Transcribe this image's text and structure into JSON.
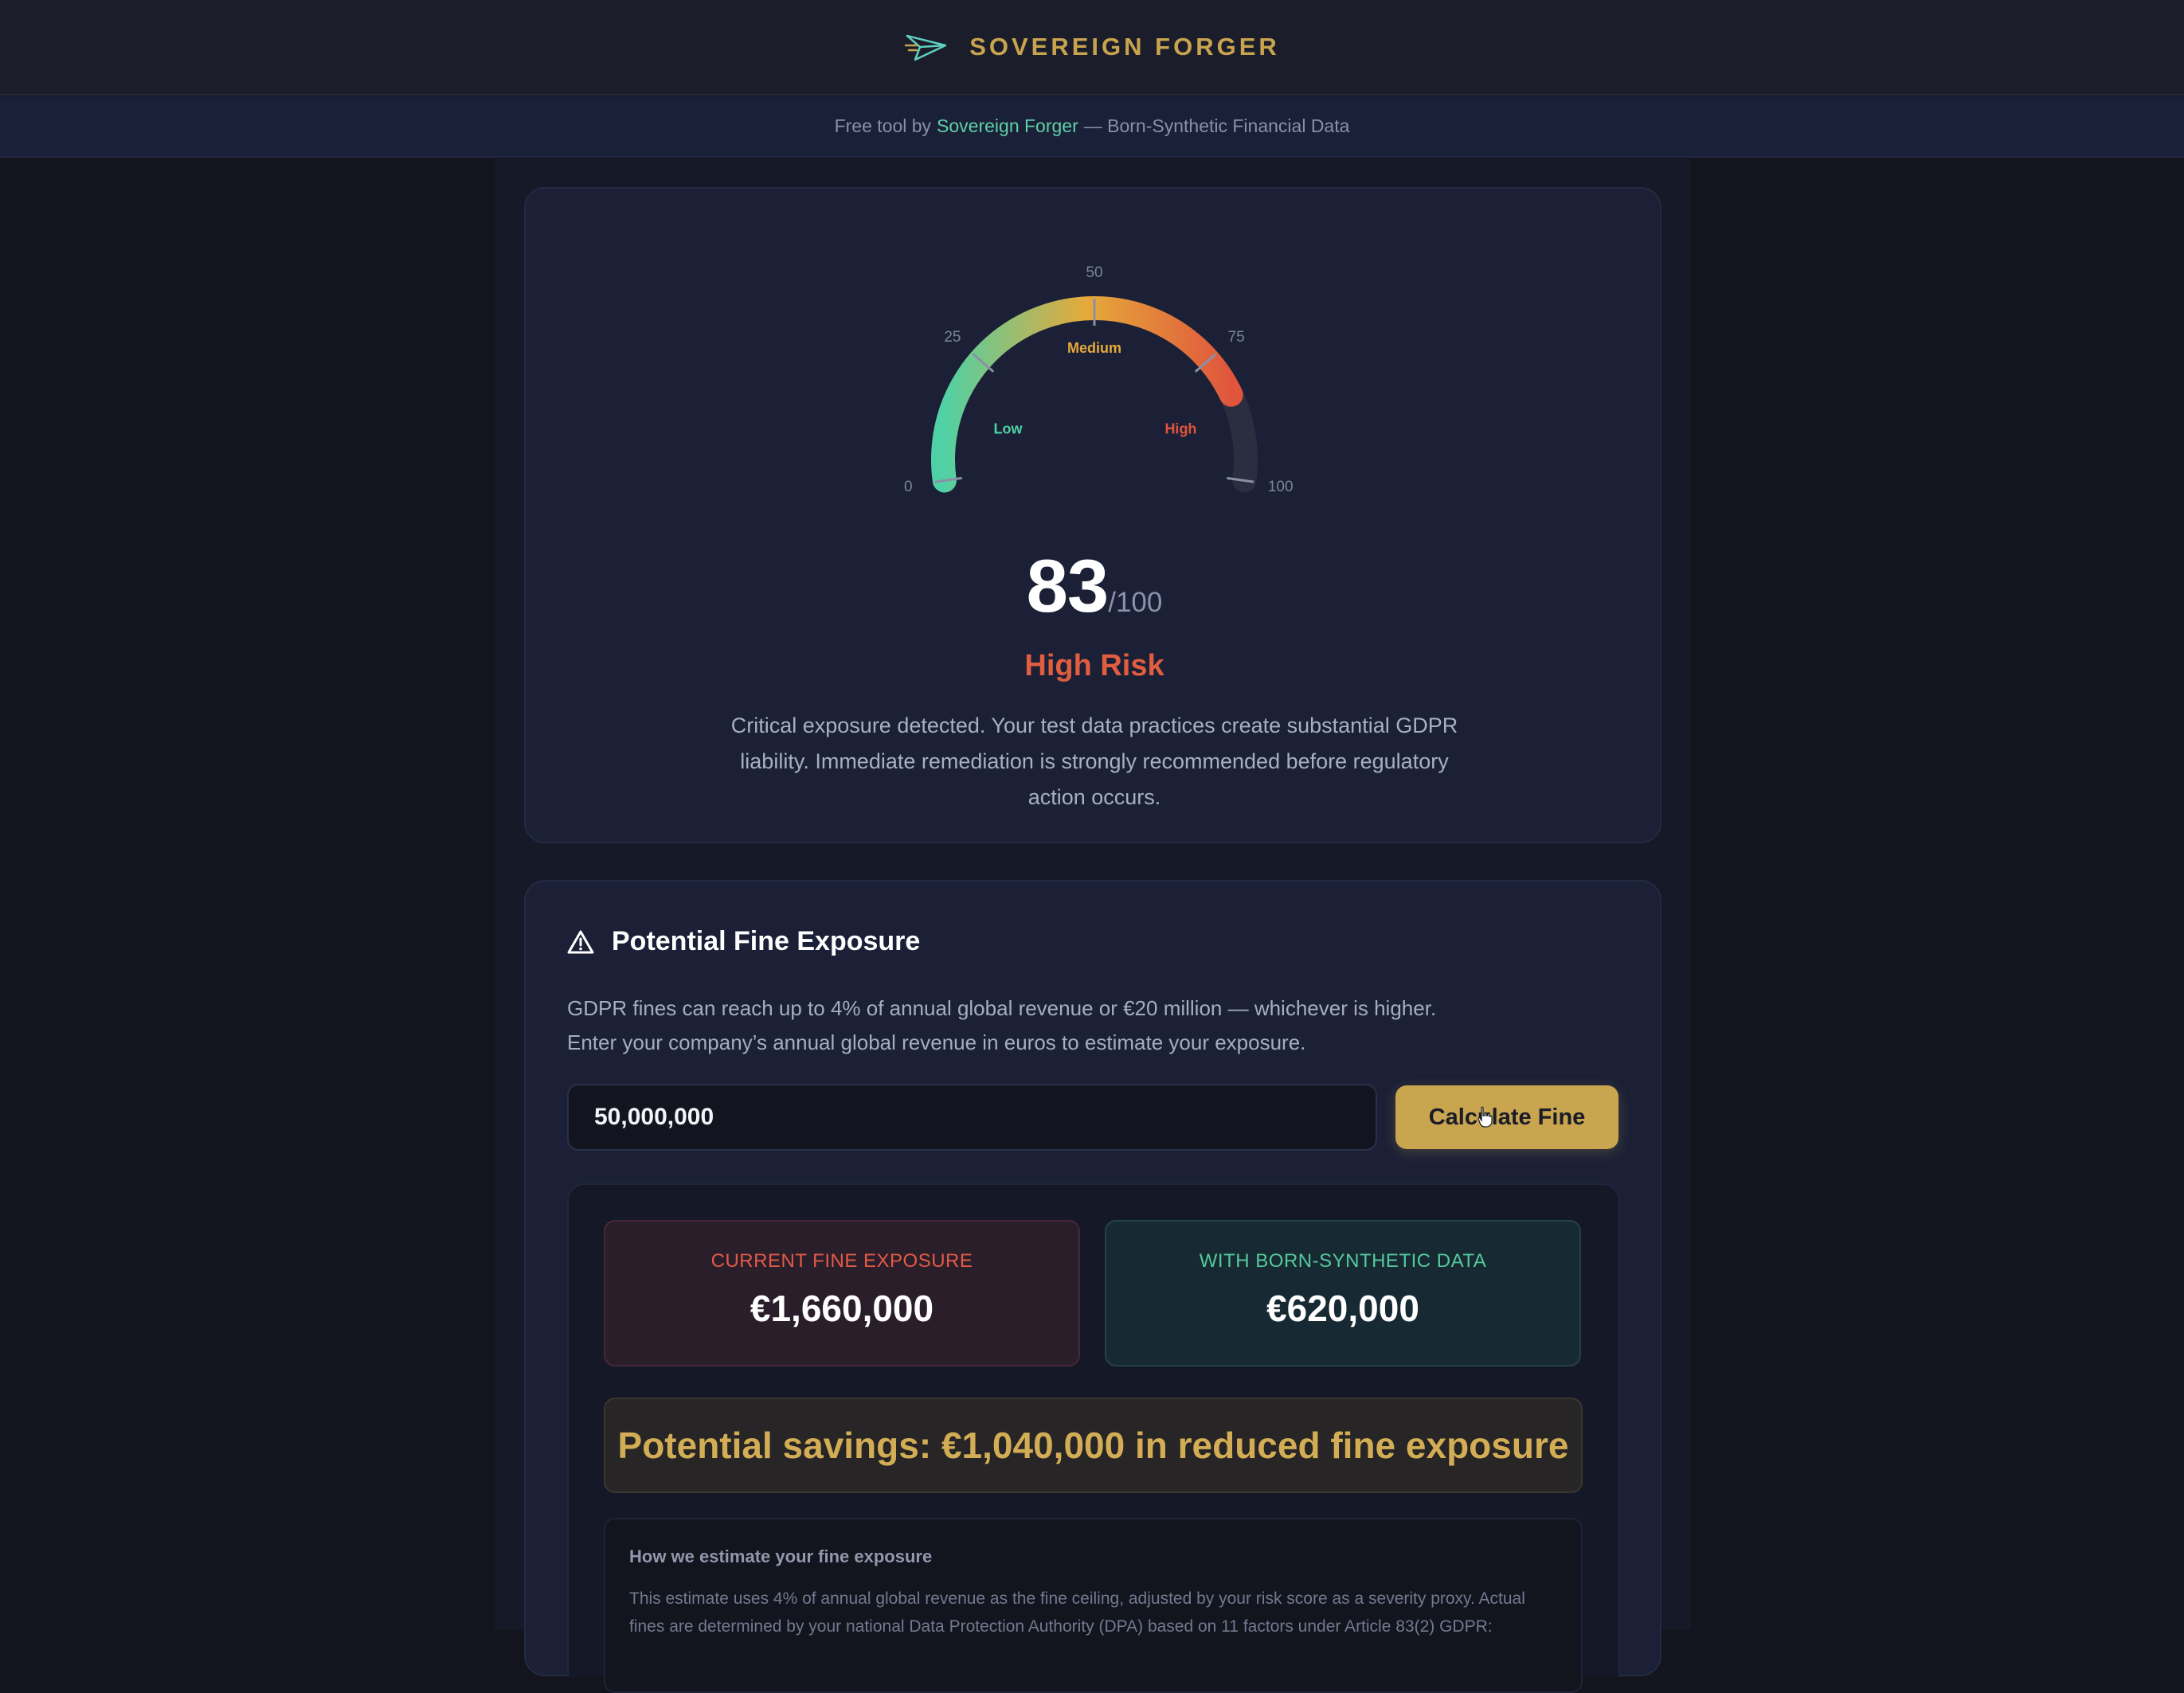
{
  "header": {
    "brand_name": "SOVEREIGN FORGER",
    "logo_icon": "paper-plane-logo-icon",
    "accent_color": "#c9a44f"
  },
  "subheader": {
    "prefix": "Free tool by",
    "link": "Sovereign Forger",
    "suffix": "— Born-Synthetic Financial Data"
  },
  "risk_score": {
    "score": 83,
    "gauge": {
      "min": 0,
      "max": 100,
      "ticks": [
        "0",
        "25",
        "50",
        "75",
        "100"
      ],
      "zones": [
        "Low",
        "Medium",
        "High"
      ],
      "colors": {
        "low": "#4fd1a5",
        "medium": "#e6a93a",
        "high": "#e0553c",
        "track": "#2a2e40"
      }
    },
    "score_value": "83",
    "score_max": "/100",
    "level": "High Risk",
    "description": "Critical exposure detected. Your test data practices create substantial GDPR liability. Immediate remediation is strongly recommended before regulatory action occurs."
  },
  "fine": {
    "title": "Potential Fine Exposure",
    "description_line1": "GDPR fines can reach up to 4% of annual global revenue or €20 million — whichever is higher.",
    "description_line2": "Enter your company’s annual global revenue in euros to estimate your exposure.",
    "revenue_value": "50,000,000",
    "calculate_label": "Calculate Fine",
    "current_label": "CURRENT FINE EXPOSURE",
    "current_value": "€1,660,000",
    "synthetic_label": "WITH BORN-SYNTHETIC DATA",
    "synthetic_value": "€620,000",
    "savings": "Potential savings: €1,040,000 in reduced fine exposure",
    "method_title": "How we estimate your fine exposure",
    "method_text": "This estimate uses 4% of annual global revenue as the fine ceiling, adjusted by your risk score as a severity proxy. Actual fines are determined by your national Data Protection Authority (DPA) based on 11 factors under Article 83(2) GDPR:"
  }
}
